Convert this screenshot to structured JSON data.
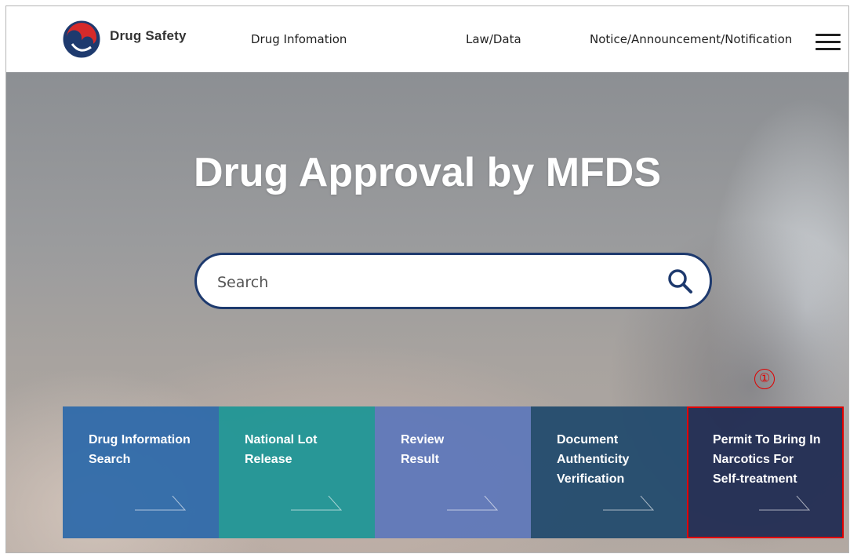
{
  "header": {
    "brand": "Drug Safety",
    "nav": {
      "drug_info": "Drug Infomation",
      "law": "Law/Data",
      "notice": "Notice/Announcement/Notification"
    }
  },
  "hero": {
    "title": "Drug Approval by MFDS",
    "search": {
      "placeholder": "Search"
    }
  },
  "annotation": "①",
  "tiles": [
    {
      "label": "Drug Information\nSearch"
    },
    {
      "label": "National Lot\nRelease"
    },
    {
      "label": "Review\nResult"
    },
    {
      "label": "Document\nAuthenticity\nVerification"
    },
    {
      "label": "Permit To Bring In\nNarcotics For\nSelf-treatment"
    }
  ],
  "colors": {
    "search_border": "#1e3a6e",
    "tile_1": "#2f6aaa",
    "tile_2": "#209696",
    "tile_3": "#5f78b9",
    "tile_4": "#244c6e",
    "tile_5": "#243055",
    "highlight": "#e00000"
  },
  "icons": {
    "logo": "korea-government-taeguk-logo",
    "menu": "hamburger-menu-icon",
    "search": "magnifier-icon",
    "tile_arrow": "arrow-right-icon"
  }
}
